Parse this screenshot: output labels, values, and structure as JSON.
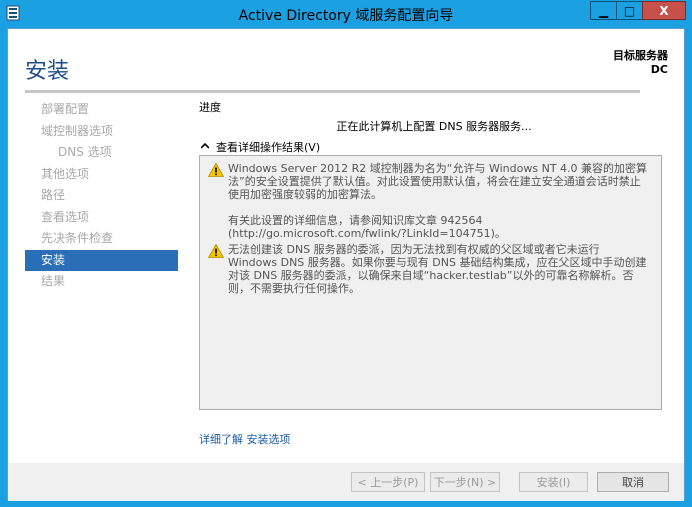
{
  "window": {
    "title": "Active Directory 域服务配置向导",
    "controls": {
      "minimize": "▁",
      "maximize": "□",
      "close": "X"
    }
  },
  "header": {
    "page_title": "安装",
    "target_server_label": "目标服务器",
    "target_server_name": "DC"
  },
  "nav": {
    "items": [
      {
        "label": "部署配置",
        "state": "disabled"
      },
      {
        "label": "域控制器选项",
        "state": "disabled"
      },
      {
        "label": "DNS 选项",
        "state": "disabled",
        "sub": true
      },
      {
        "label": "其他选项",
        "state": "disabled"
      },
      {
        "label": "路径",
        "state": "disabled"
      },
      {
        "label": "查看选项",
        "state": "disabled"
      },
      {
        "label": "先决条件检查",
        "state": "disabled"
      },
      {
        "label": "安装",
        "state": "active"
      },
      {
        "label": "结果",
        "state": "disabled"
      }
    ]
  },
  "content": {
    "progress_label": "进度",
    "status_text": "正在此计算机上配置 DNS 服务器服务...",
    "details_toggle_label": "查看详细操作结果(V)",
    "messages": [
      {
        "icon": "warning-icon",
        "paragraphs": [
          "Windows Server 2012 R2 域控制器为名为“允许与 Windows NT 4.0 兼容的加密算法”的安全设置提供了默认值。对此设置使用默认值，将会在建立安全通道会话时禁止使用加密强度较弱的加密算法。",
          "有关此设置的详细信息，请参阅知识库文章 942564 (http://go.microsoft.com/fwlink/?LinkId=104751)。"
        ]
      },
      {
        "icon": "warning-icon",
        "paragraphs": [
          "无法创建该 DNS 服务器的委派，因为无法找到有权威的父区域或者它未运行 Windows DNS 服务器。如果你要与现有 DNS 基础结构集成，应在父区域中手动创建对该 DNS 服务器的委派，以确保来自域“hacker.testlab”以外的可靠名称解析。否则，不需要执行任何操作。"
        ]
      }
    ],
    "learn_more_link": "详细了解 安装选项"
  },
  "footer": {
    "prev_button": "< 上一步(P)",
    "next_button": "下一步(N) >",
    "install_button": "安装(I)",
    "cancel_button": "取消"
  },
  "colors": {
    "title_bar": "#1ba1e2",
    "page_title": "#1e4e8c",
    "nav_active": "#2a6eb8",
    "link": "#1a5ea8",
    "warning": "#f5c400"
  }
}
